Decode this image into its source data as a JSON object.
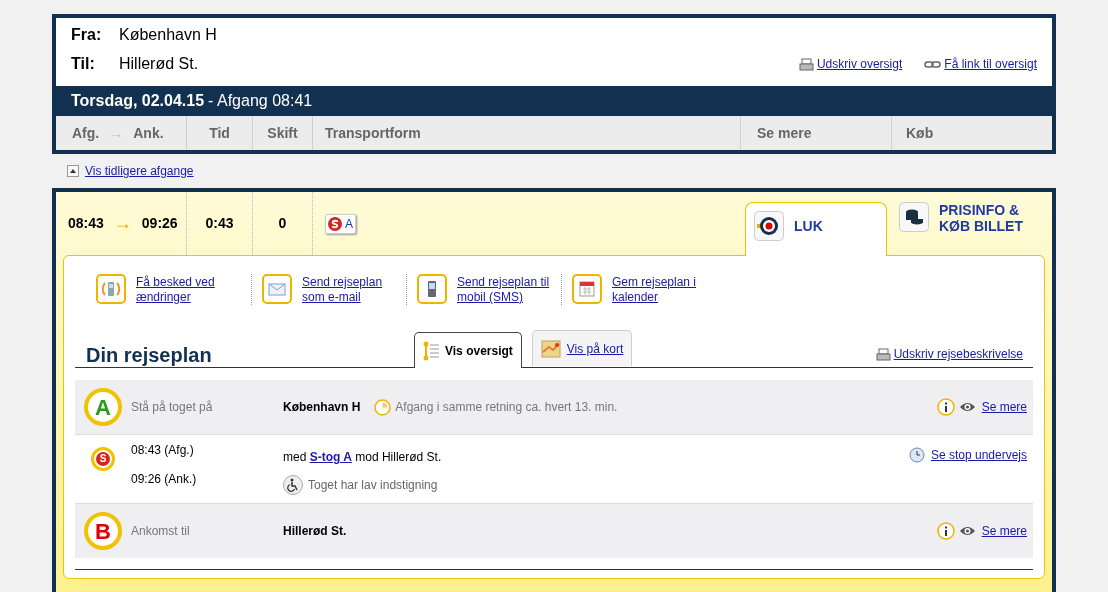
{
  "search": {
    "from_label": "Fra:",
    "from": "København H",
    "to_label": "Til:",
    "to": "Hillerød St.",
    "links": [
      {
        "kind": "print",
        "label": "Udskriv oversigt"
      },
      {
        "kind": "link",
        "label": "Få link til oversigt"
      }
    ],
    "date": "Torsdag, 02.04.15",
    "departure": "- Afgang 08:41"
  },
  "columns": {
    "dep": "Afg.",
    "arrow": "→",
    "arr": "Ank.",
    "duration": "Tid",
    "changes": "Skift",
    "transport": "Transportform",
    "more": "Se mere",
    "buy": "Køb"
  },
  "earlier_link": "Vis tidligere afgange",
  "journey": {
    "dep": "08:43",
    "arrow": "→",
    "arr": "09:26",
    "duration": "0:43",
    "changes": "0",
    "line_badge": "A",
    "tabs": [
      {
        "kind": "close",
        "label": "LUK",
        "selected": true
      },
      {
        "kind": "price",
        "label": "PRISINFO & KØB BILLET",
        "selected": false
      }
    ]
  },
  "actions": [
    {
      "kind": "notify",
      "label": "Få besked ved ændringer"
    },
    {
      "kind": "email",
      "label": "Send rejseplan som e-mail"
    },
    {
      "kind": "sms",
      "label": "Send rejseplan til mobil (SMS)"
    },
    {
      "kind": "calendar",
      "label": "Gem rejseplan i kalender"
    }
  ],
  "plan": {
    "title": "Din rejseplan",
    "views": [
      {
        "kind": "list",
        "label": "Vis oversigt",
        "selected": true
      },
      {
        "kind": "map",
        "label": "Vis på kort",
        "selected": false
      }
    ],
    "print_link": "Udskriv rejsebeskrivelse",
    "stops": [
      {
        "kind": "origin",
        "marker": "A",
        "label": "Stå på toget på",
        "station": "København H",
        "note": "Afgang i samme retning ca. hvert 13. min.",
        "link": "Se mere"
      },
      {
        "kind": "leg",
        "marker": "S",
        "dep_time": "08:43 (Afg.)",
        "arr_time": "09:26 (Ank.)",
        "prefix": "med",
        "line": "S-tog A",
        "suffix": "mod Hillerød St.",
        "access": "Toget har lav indstigning",
        "link": "Se stop undervejs"
      },
      {
        "kind": "destination",
        "marker": "B",
        "label": "Ankomst til",
        "station": "Hillerød St.",
        "link": "Se mere"
      }
    ]
  }
}
